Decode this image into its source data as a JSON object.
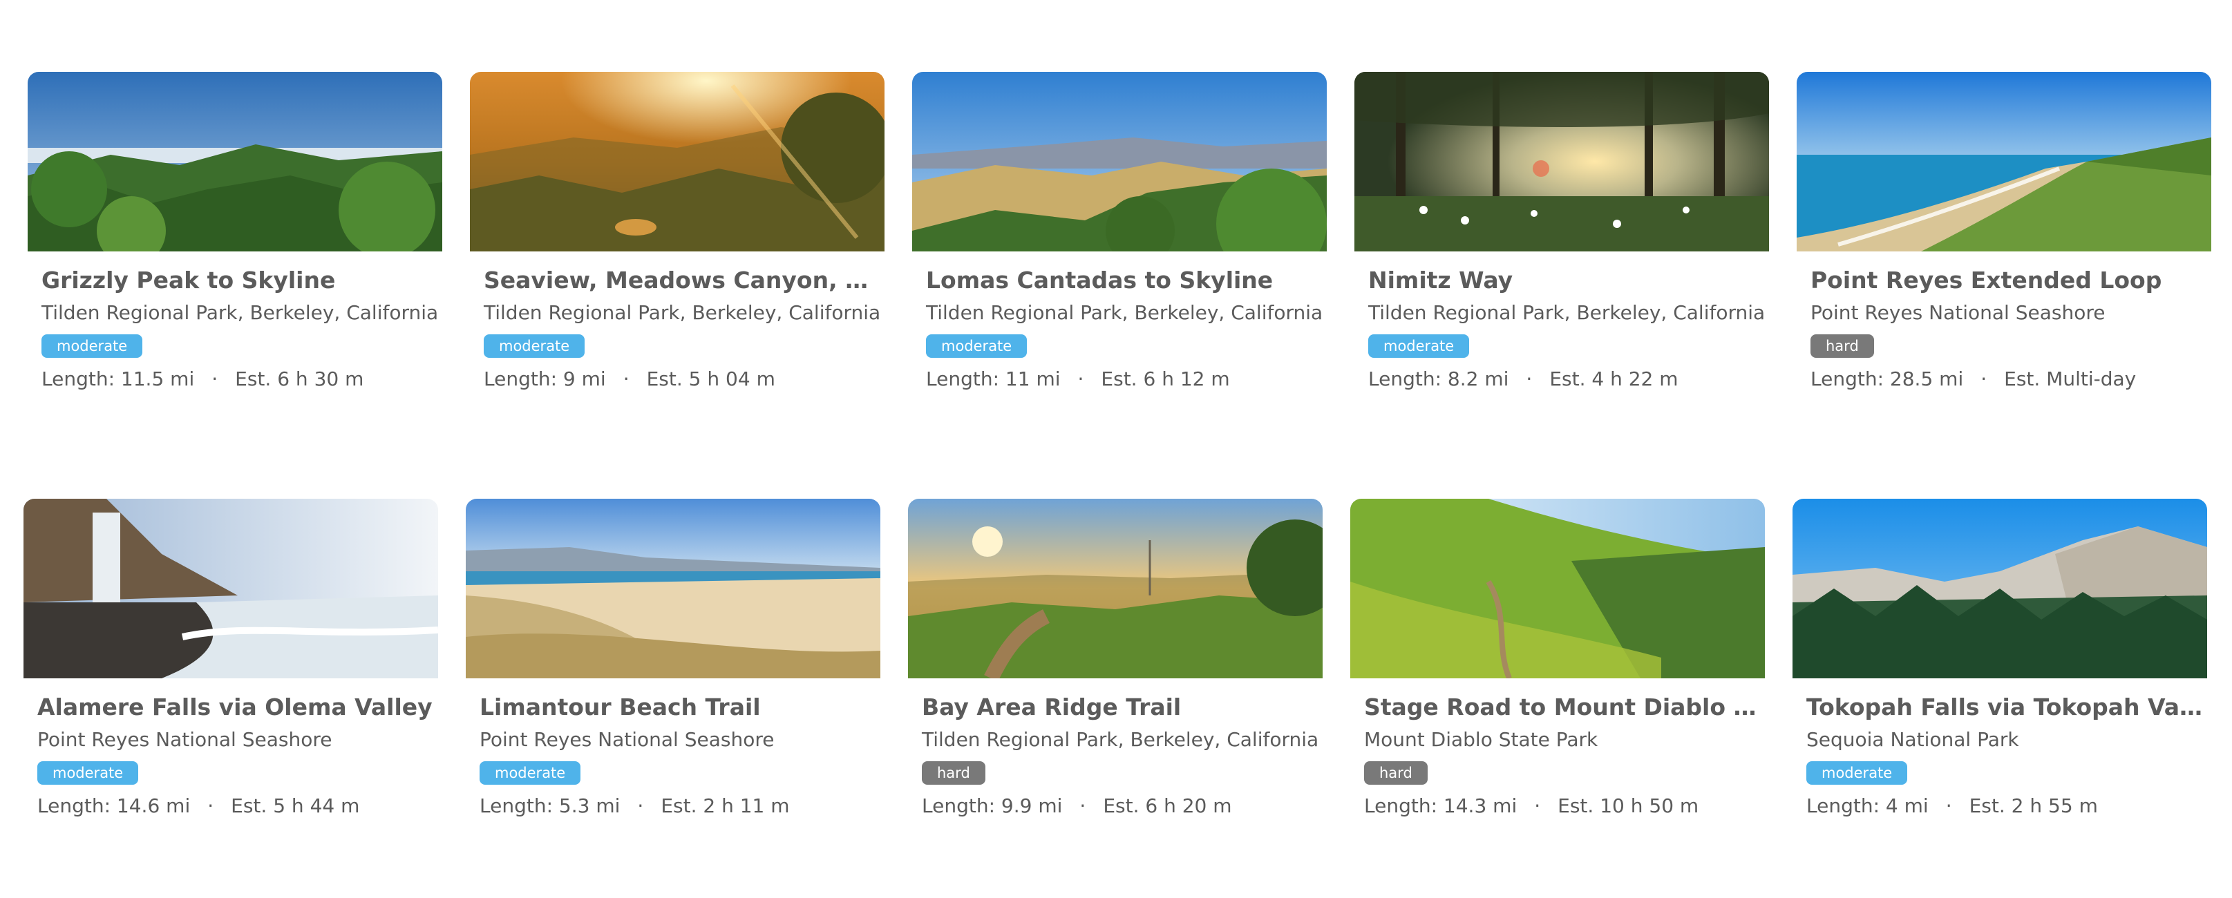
{
  "labels": {
    "length_prefix": "Length: ",
    "est_prefix": "Est. "
  },
  "colors": {
    "moderate_badge": "#4fb3ea",
    "hard_badge": "#797979",
    "text": "#5b5b5b"
  },
  "trails": [
    {
      "title": "Grizzly Peak to Skyline",
      "location": "Tilden Regional Park, Berkeley, California",
      "difficulty": "moderate",
      "length": "11.5 mi",
      "estimate": "6 h 30 m",
      "image": "ridge-overlook-photo"
    },
    {
      "title": "Seaview, Meadows Canyon, Wildcat Gorge",
      "location": "Tilden Regional Park, Berkeley, California",
      "difficulty": "moderate",
      "length": "9 mi",
      "estimate": "5 h 04 m",
      "image": "sunset-haze-photo"
    },
    {
      "title": "Lomas Cantadas to Skyline",
      "location": "Tilden Regional Park, Berkeley, California",
      "difficulty": "moderate",
      "length": "11 mi",
      "estimate": "6 h 12 m",
      "image": "golden-hills-photo"
    },
    {
      "title": "Nimitz Way",
      "location": "Tilden Regional Park, Berkeley, California",
      "difficulty": "moderate",
      "length": "8.2 mi",
      "estimate": "4 h 22 m",
      "image": "forest-sunburst-photo"
    },
    {
      "title": "Point Reyes Extended Loop",
      "location": "Point Reyes National Seashore",
      "difficulty": "hard",
      "length": "28.5 mi",
      "estimate": "Multi-day",
      "image": "coastal-bluff-photo"
    },
    {
      "title": "Alamere Falls via Olema Valley",
      "location": "Point Reyes National Seashore",
      "difficulty": "moderate",
      "length": "14.6 mi",
      "estimate": "5 h 44 m",
      "image": "beach-waterfall-photo"
    },
    {
      "title": "Limantour Beach Trail",
      "location": "Point Reyes National Seashore",
      "difficulty": "moderate",
      "length": "5.3 mi",
      "estimate": "2 h 11 m",
      "image": "dune-beach-photo"
    },
    {
      "title": "Bay Area Ridge Trail",
      "location": "Tilden Regional Park, Berkeley, California",
      "difficulty": "hard",
      "length": "9.9 mi",
      "estimate": "6 h 20 m",
      "image": "ridge-sunset-trail-photo"
    },
    {
      "title": "Stage Road to Mount Diablo Summit",
      "location": "Mount Diablo State Park",
      "difficulty": "hard",
      "length": "14.3 mi",
      "estimate": "10 h 50 m",
      "image": "green-hillside-path-photo"
    },
    {
      "title": "Tokopah Falls via Tokopah Valley",
      "location": "Sequoia National Park",
      "difficulty": "moderate",
      "length": "4 mi",
      "estimate": "2 h 55 m",
      "image": "granite-peaks-photo"
    }
  ]
}
